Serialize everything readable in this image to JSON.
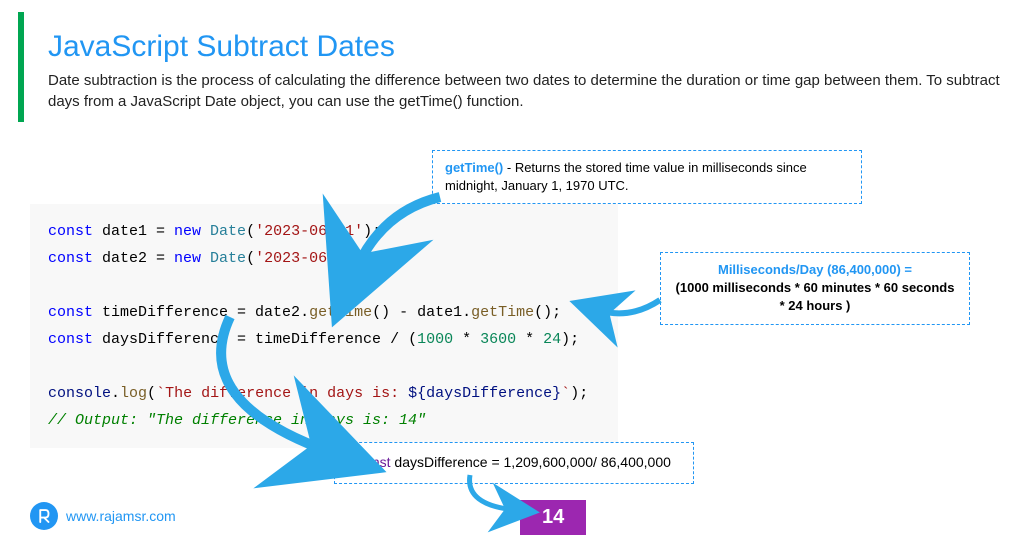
{
  "header": {
    "title": "JavaScript Subtract Dates",
    "subtitle": "Date subtraction is the process of calculating the difference between two dates to determine the duration or time gap between them. To subtract days from a JavaScript Date object, you can use the getTime() function."
  },
  "code": {
    "line1_const": "const",
    "line1_var": " date1 = ",
    "line1_new": "new",
    "line1_type": " Date",
    "line1_paren_open": "(",
    "line1_str": "'2023-06-01'",
    "line1_end": ");",
    "line2_const": "const",
    "line2_var": " date2 = ",
    "line2_new": "new",
    "line2_type": " Date",
    "line2_paren_open": "(",
    "line2_str": "'2023-06-15'",
    "line2_end": ");",
    "line4_const": "const",
    "line4_var": " timeDifference = date2",
    "line4_dot1": ".",
    "line4_method1": "getTime",
    "line4_mid": "() - date1",
    "line4_dot2": ".",
    "line4_method2": "getTime",
    "line4_end": "();",
    "line5_const": "const",
    "line5_var": " daysDifference = timeDifference / (",
    "line5_n1": "1000",
    "line5_op1": " * ",
    "line5_n2": "3600",
    "line5_op2": " * ",
    "line5_n3": "24",
    "line5_end": ");",
    "line7_obj": "console",
    "line7_dot": ".",
    "line7_method": "log",
    "line7_open": "(",
    "line7_tstr1": "`The difference in days is: ",
    "line7_tvar_open": "${",
    "line7_tvar": "daysDifference",
    "line7_tvar_close": "}",
    "line7_tstr2": "`",
    "line7_end": ");",
    "line8_comment": "// Output: \"The difference in days is: 14\""
  },
  "callouts": {
    "c1_bold": "getTime()",
    "c1_text": " - Returns the stored time value in milliseconds since midnight, January 1, 1970 UTC.",
    "c2_blue": "Milliseconds/Day (86,400,000) =",
    "c2_black": "(1000 milliseconds * 60 minutes * 60 seconds * 24 hours )",
    "c3_const": "const",
    "c3_text": " daysDifference = 1,209,600,000/ 86,400,000"
  },
  "result": "14",
  "footer": {
    "url": "www.rajamsr.com"
  }
}
